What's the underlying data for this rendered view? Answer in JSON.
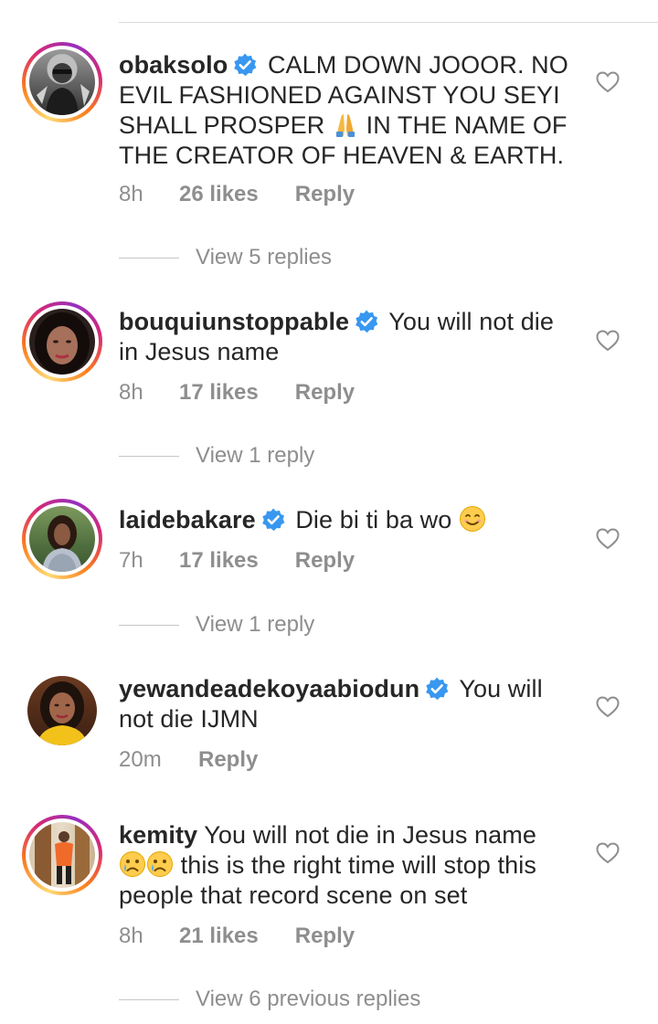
{
  "comments": [
    {
      "username": "obaksolo",
      "verified": true,
      "text_line1": "CALM DOWN JOOOR. NO",
      "text_line2": "EVIL FASHIONED AGAINST YOU SEYI",
      "text_line3_a": "SHALL PROSPER",
      "text_line3_b": "IN THE NAME OF",
      "text_line4": "THE CREATOR OF HEAVEN & EARTH.",
      "emoji": "folded-hands-icon",
      "time": "8h",
      "likes": "26 likes",
      "reply_label": "Reply",
      "view_replies": "View 5 replies"
    },
    {
      "username": "bouquiunstoppable",
      "verified": true,
      "text_line1": "You will not die",
      "text_line2": "in Jesus name",
      "time": "8h",
      "likes": "17 likes",
      "reply_label": "Reply",
      "view_replies": "View 1 reply"
    },
    {
      "username": "laidebakare",
      "verified": true,
      "text_line1": "Die bi ti ba wo",
      "emoji": "smiling-face-icon",
      "time": "7h",
      "likes": "17 likes",
      "reply_label": "Reply",
      "view_replies": "View 1 reply"
    },
    {
      "username": "yewandeadekoyaabiodun",
      "verified": true,
      "text_line1": "You will",
      "text_line2": "not die IJMN",
      "time": "20m",
      "reply_label": "Reply"
    },
    {
      "username": "kemity",
      "verified": false,
      "text_line1": "You will not die in Jesus name",
      "text_line2": "this is the right time will stop this",
      "text_line3": "people that record scene on set",
      "emoji": "crying-face-icon",
      "time": "8h",
      "likes": "21 likes",
      "reply_label": "Reply",
      "view_replies": "View 6 previous replies"
    }
  ],
  "colors": {
    "text": "#262626",
    "secondary": "#8e8e8e",
    "verified_blue": "#3897f0",
    "divider": "#dbdbdb"
  }
}
